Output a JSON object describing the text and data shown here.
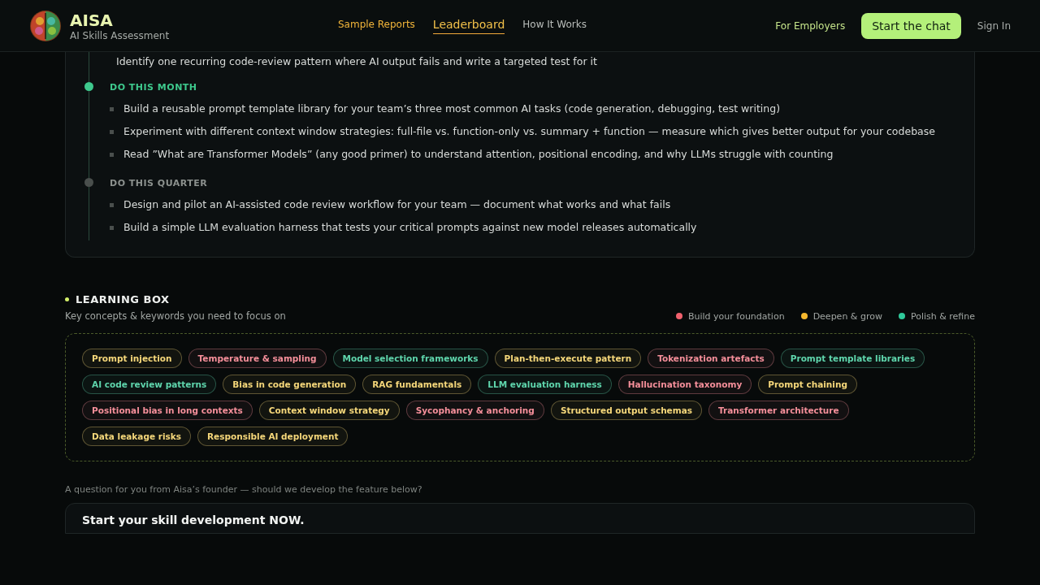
{
  "header": {
    "brand": "AISA",
    "tagline": "AI Skills Assessment",
    "nav": [
      {
        "label": "Sample Reports",
        "selected": false
      },
      {
        "label": "Leaderboard",
        "selected": true
      },
      {
        "label": "How It Works",
        "selected": false
      }
    ],
    "employers": "For Employers",
    "cta": "Start the chat",
    "signin": "Sign In"
  },
  "plan": {
    "partial_item": "Identify one recurring code-review pattern where AI output fails and write a targeted test for it",
    "phases": [
      {
        "title": "DO THIS MONTH",
        "active": true,
        "items": [
          "Build a reusable prompt template library for your team’s three most common AI tasks (code generation, debugging, test writing)",
          "Experiment with different context window strategies: full-file vs. function-only vs. summary + function — measure which gives better output for your codebase",
          "Read ”What are Transformer Models” (any good primer) to understand attention, positional encoding, and why LLMs struggle with counting"
        ]
      },
      {
        "title": "DO THIS QUARTER",
        "active": false,
        "items": [
          "Design and pilot an AI-assisted code review workflow for your team — document what works and what fails",
          "Build a simple LLM evaluation harness that tests your critical prompts against new model releases automatically"
        ]
      }
    ]
  },
  "learning_box": {
    "title": "LEARNING BOX",
    "subtitle": "Key concepts & keywords you need to focus on",
    "legend": [
      {
        "label": "Build your foundation",
        "color": "#f0616d"
      },
      {
        "label": "Deepen & grow",
        "color": "#f5b82e"
      },
      {
        "label": "Polish & refine",
        "color": "#2fc99a"
      }
    ],
    "tags": [
      {
        "label": "Prompt injection",
        "color": "#f5d77a"
      },
      {
        "label": "Temperature & sampling",
        "color": "#f58f9a"
      },
      {
        "label": "Model selection frameworks",
        "color": "#5fd6ad"
      },
      {
        "label": "Plan-then-execute pattern",
        "color": "#f5d77a"
      },
      {
        "label": "Tokenization artefacts",
        "color": "#f58f9a"
      },
      {
        "label": "Prompt template libraries",
        "color": "#5fd6ad"
      },
      {
        "label": "AI code review patterns",
        "color": "#5fd6ad"
      },
      {
        "label": "Bias in code generation",
        "color": "#f5d77a"
      },
      {
        "label": "RAG fundamentals",
        "color": "#f5d77a"
      },
      {
        "label": "LLM evaluation harness",
        "color": "#5fd6ad"
      },
      {
        "label": "Hallucination taxonomy",
        "color": "#f58f9a"
      },
      {
        "label": "Prompt chaining",
        "color": "#f5d77a"
      },
      {
        "label": "Positional bias in long contexts",
        "color": "#f58f9a"
      },
      {
        "label": "Context window strategy",
        "color": "#f5d77a"
      },
      {
        "label": "Sycophancy & anchoring",
        "color": "#f58f9a"
      },
      {
        "label": "Structured output schemas",
        "color": "#f5d77a"
      },
      {
        "label": "Transformer architecture",
        "color": "#f58f9a"
      },
      {
        "label": "Data leakage risks",
        "color": "#f5d77a"
      },
      {
        "label": "Responsible AI deployment",
        "color": "#f5d77a"
      }
    ]
  },
  "question": "A question for you from Aisa’s founder — should we develop the feature below?",
  "feature_card": {
    "title": "Start your skill development NOW."
  }
}
